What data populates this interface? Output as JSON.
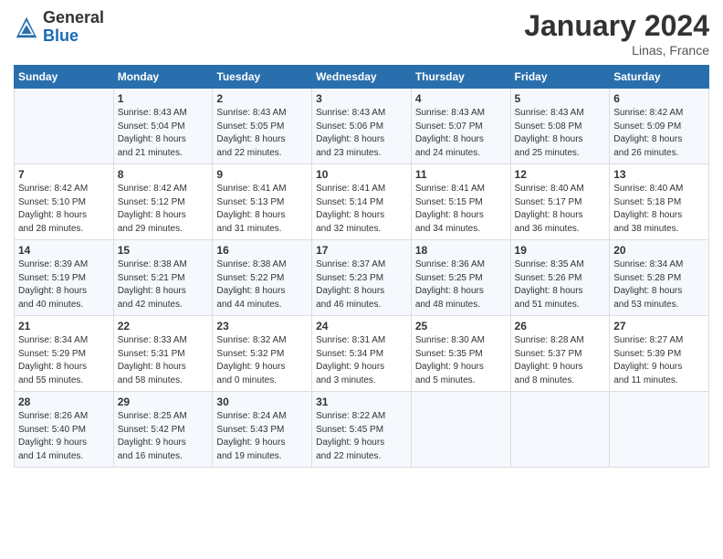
{
  "logo": {
    "general": "General",
    "blue": "Blue"
  },
  "header": {
    "title": "January 2024",
    "location": "Linas, France"
  },
  "days_of_week": [
    "Sunday",
    "Monday",
    "Tuesday",
    "Wednesday",
    "Thursday",
    "Friday",
    "Saturday"
  ],
  "weeks": [
    [
      {
        "num": "",
        "sunrise": "",
        "sunset": "",
        "daylight": ""
      },
      {
        "num": "1",
        "sunrise": "Sunrise: 8:43 AM",
        "sunset": "Sunset: 5:04 PM",
        "daylight": "Daylight: 8 hours and 21 minutes."
      },
      {
        "num": "2",
        "sunrise": "Sunrise: 8:43 AM",
        "sunset": "Sunset: 5:05 PM",
        "daylight": "Daylight: 8 hours and 22 minutes."
      },
      {
        "num": "3",
        "sunrise": "Sunrise: 8:43 AM",
        "sunset": "Sunset: 5:06 PM",
        "daylight": "Daylight: 8 hours and 23 minutes."
      },
      {
        "num": "4",
        "sunrise": "Sunrise: 8:43 AM",
        "sunset": "Sunset: 5:07 PM",
        "daylight": "Daylight: 8 hours and 24 minutes."
      },
      {
        "num": "5",
        "sunrise": "Sunrise: 8:43 AM",
        "sunset": "Sunset: 5:08 PM",
        "daylight": "Daylight: 8 hours and 25 minutes."
      },
      {
        "num": "6",
        "sunrise": "Sunrise: 8:42 AM",
        "sunset": "Sunset: 5:09 PM",
        "daylight": "Daylight: 8 hours and 26 minutes."
      }
    ],
    [
      {
        "num": "7",
        "sunrise": "",
        "sunset": "",
        "daylight": ""
      },
      {
        "num": "8",
        "sunrise": "Sunrise: 8:42 AM",
        "sunset": "Sunset: 5:12 PM",
        "daylight": "Daylight: 8 hours and 29 minutes."
      },
      {
        "num": "9",
        "sunrise": "Sunrise: 8:41 AM",
        "sunset": "Sunset: 5:13 PM",
        "daylight": "Daylight: 8 hours and 31 minutes."
      },
      {
        "num": "10",
        "sunrise": "Sunrise: 8:41 AM",
        "sunset": "Sunset: 5:14 PM",
        "daylight": "Daylight: 8 hours and 32 minutes."
      },
      {
        "num": "11",
        "sunrise": "Sunrise: 8:41 AM",
        "sunset": "Sunset: 5:15 PM",
        "daylight": "Daylight: 8 hours and 34 minutes."
      },
      {
        "num": "12",
        "sunrise": "Sunrise: 8:40 AM",
        "sunset": "Sunset: 5:17 PM",
        "daylight": "Daylight: 8 hours and 36 minutes."
      },
      {
        "num": "13",
        "sunrise": "Sunrise: 8:40 AM",
        "sunset": "Sunset: 5:18 PM",
        "daylight": "Daylight: 8 hours and 38 minutes."
      }
    ],
    [
      {
        "num": "14",
        "sunrise": "",
        "sunset": "",
        "daylight": ""
      },
      {
        "num": "15",
        "sunrise": "Sunrise: 8:38 AM",
        "sunset": "Sunset: 5:21 PM",
        "daylight": "Daylight: 8 hours and 42 minutes."
      },
      {
        "num": "16",
        "sunrise": "Sunrise: 8:38 AM",
        "sunset": "Sunset: 5:22 PM",
        "daylight": "Daylight: 8 hours and 44 minutes."
      },
      {
        "num": "17",
        "sunrise": "Sunrise: 8:37 AM",
        "sunset": "Sunset: 5:23 PM",
        "daylight": "Daylight: 8 hours and 46 minutes."
      },
      {
        "num": "18",
        "sunrise": "Sunrise: 8:36 AM",
        "sunset": "Sunset: 5:25 PM",
        "daylight": "Daylight: 8 hours and 48 minutes."
      },
      {
        "num": "19",
        "sunrise": "Sunrise: 8:35 AM",
        "sunset": "Sunset: 5:26 PM",
        "daylight": "Daylight: 8 hours and 51 minutes."
      },
      {
        "num": "20",
        "sunrise": "Sunrise: 8:34 AM",
        "sunset": "Sunset: 5:28 PM",
        "daylight": "Daylight: 8 hours and 53 minutes."
      }
    ],
    [
      {
        "num": "21",
        "sunrise": "Sunrise: 8:34 AM",
        "sunset": "Sunset: 5:29 PM",
        "daylight": "Daylight: 8 hours and 55 minutes."
      },
      {
        "num": "22",
        "sunrise": "Sunrise: 8:33 AM",
        "sunset": "Sunset: 5:31 PM",
        "daylight": "Daylight: 8 hours and 58 minutes."
      },
      {
        "num": "23",
        "sunrise": "Sunrise: 8:32 AM",
        "sunset": "Sunset: 5:32 PM",
        "daylight": "Daylight: 9 hours and 0 minutes."
      },
      {
        "num": "24",
        "sunrise": "Sunrise: 8:31 AM",
        "sunset": "Sunset: 5:34 PM",
        "daylight": "Daylight: 9 hours and 3 minutes."
      },
      {
        "num": "25",
        "sunrise": "Sunrise: 8:30 AM",
        "sunset": "Sunset: 5:35 PM",
        "daylight": "Daylight: 9 hours and 5 minutes."
      },
      {
        "num": "26",
        "sunrise": "Sunrise: 8:28 AM",
        "sunset": "Sunset: 5:37 PM",
        "daylight": "Daylight: 9 hours and 8 minutes."
      },
      {
        "num": "27",
        "sunrise": "Sunrise: 8:27 AM",
        "sunset": "Sunset: 5:39 PM",
        "daylight": "Daylight: 9 hours and 11 minutes."
      }
    ],
    [
      {
        "num": "28",
        "sunrise": "Sunrise: 8:26 AM",
        "sunset": "Sunset: 5:40 PM",
        "daylight": "Daylight: 9 hours and 14 minutes."
      },
      {
        "num": "29",
        "sunrise": "Sunrise: 8:25 AM",
        "sunset": "Sunset: 5:42 PM",
        "daylight": "Daylight: 9 hours and 16 minutes."
      },
      {
        "num": "30",
        "sunrise": "Sunrise: 8:24 AM",
        "sunset": "Sunset: 5:43 PM",
        "daylight": "Daylight: 9 hours and 19 minutes."
      },
      {
        "num": "31",
        "sunrise": "Sunrise: 8:22 AM",
        "sunset": "Sunset: 5:45 PM",
        "daylight": "Daylight: 9 hours and 22 minutes."
      },
      {
        "num": "",
        "sunrise": "",
        "sunset": "",
        "daylight": ""
      },
      {
        "num": "",
        "sunrise": "",
        "sunset": "",
        "daylight": ""
      },
      {
        "num": "",
        "sunrise": "",
        "sunset": "",
        "daylight": ""
      }
    ]
  ],
  "week1_sun": {
    "sunrise": "Sunrise: 8:42 AM",
    "sunset": "Sunset: 5:10 PM",
    "daylight": "Daylight: 8 hours and 28 minutes."
  },
  "week3_sun": {
    "sunrise": "Sunrise: 8:39 AM",
    "sunset": "Sunset: 5:19 PM",
    "daylight": "Daylight: 8 hours and 40 minutes."
  }
}
